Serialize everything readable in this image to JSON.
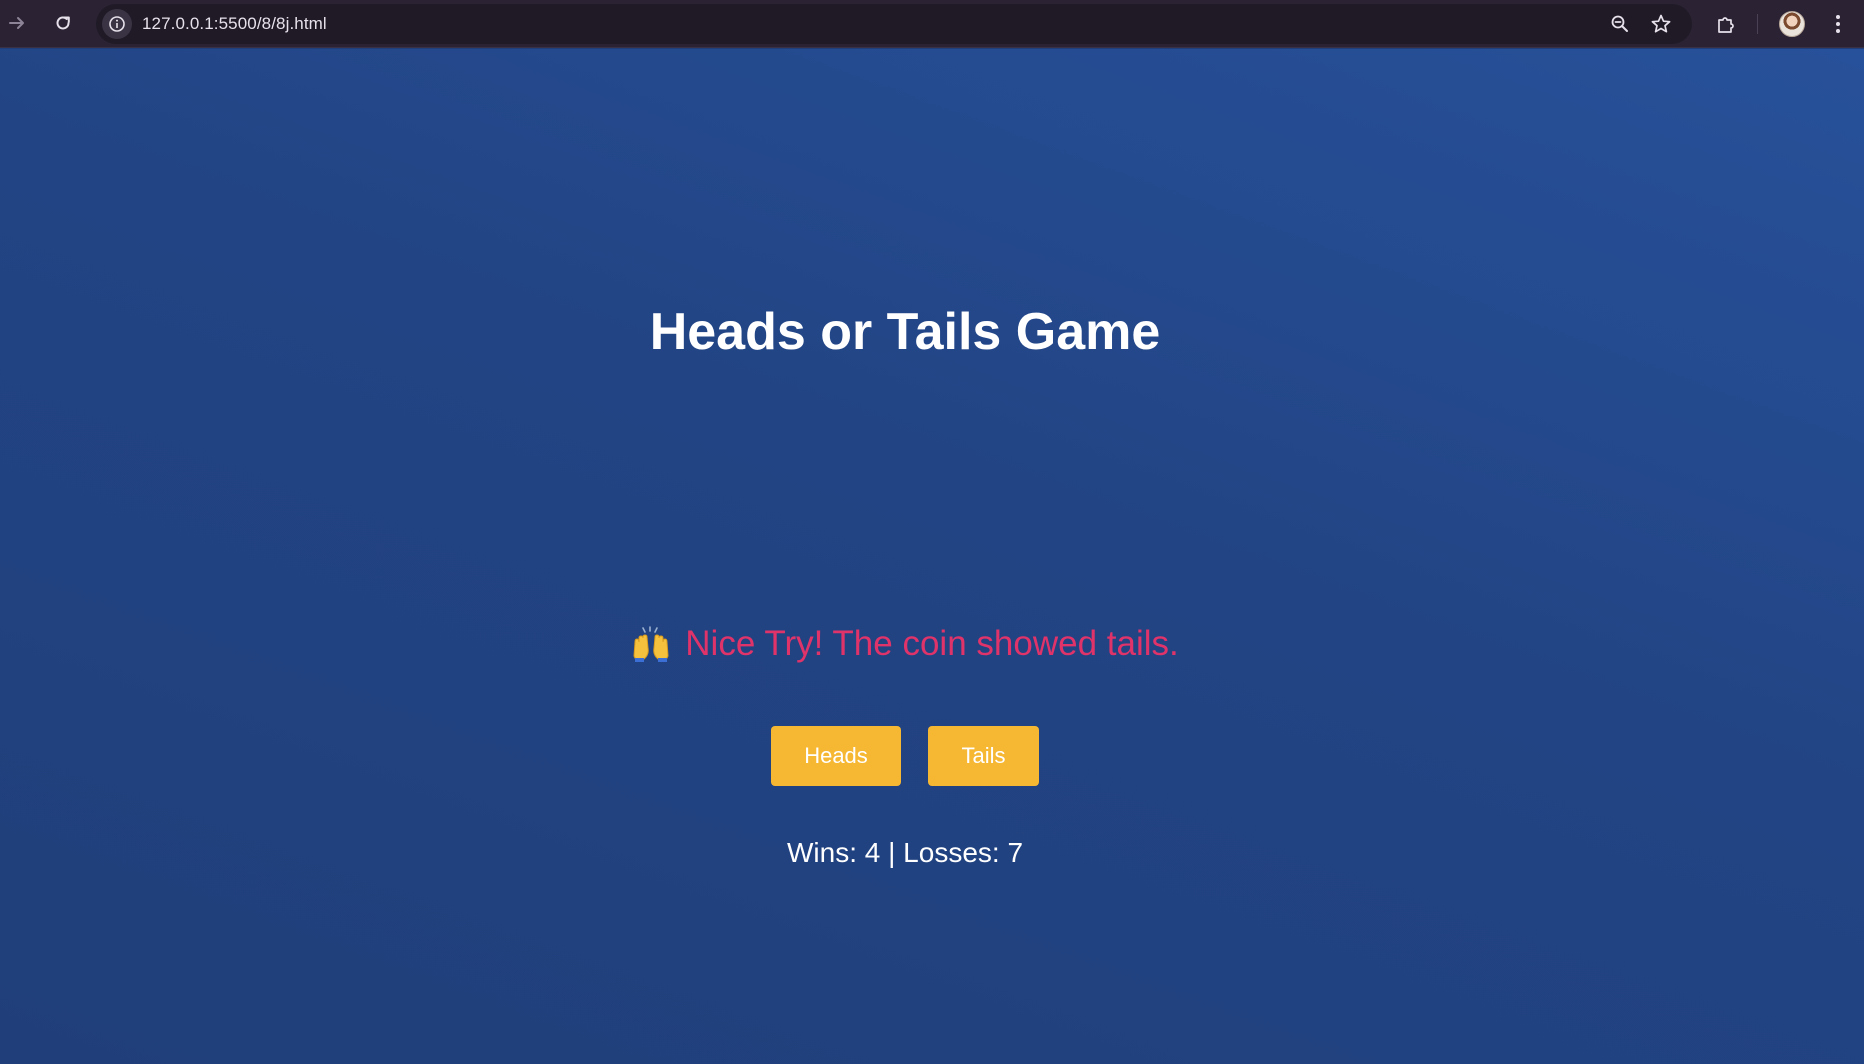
{
  "browser": {
    "url": "127.0.0.1:5500/8/8j.html",
    "icons": {
      "forward": "forward-arrow-icon",
      "reload": "reload-icon",
      "site_info": "info-icon",
      "zoom": "zoom-out-icon",
      "bookmark": "star-icon",
      "extensions": "puzzle-icon",
      "profile": "avatar",
      "menu": "kebab-menu-icon"
    }
  },
  "game": {
    "title": "Heads or Tails Game",
    "result_emoji": "raising-hands-icon",
    "result_text": "Nice Try! The coin showed tails.",
    "buttons": {
      "heads": "Heads",
      "tails": "Tails"
    },
    "score_text": "Wins: 4 | Losses: 7"
  },
  "colors": {
    "background_top": "#27519a",
    "background_bottom": "#203f7a",
    "result_text": "#e0336a",
    "button": "#f6b732",
    "chrome": "#2b2234"
  }
}
